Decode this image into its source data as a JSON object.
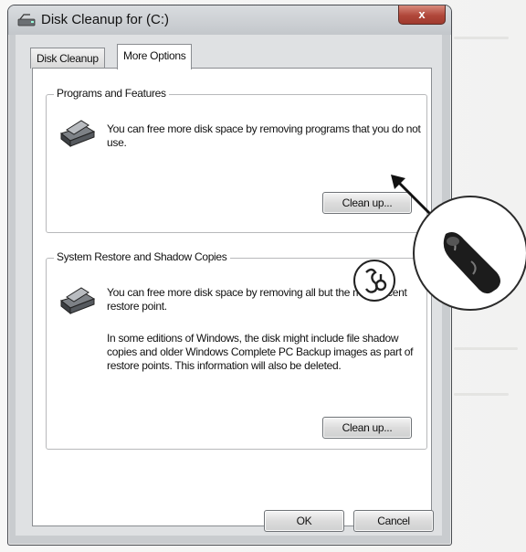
{
  "window": {
    "title": "Disk Cleanup for (C:)",
    "close_symbol": "x"
  },
  "tabs": [
    {
      "label": "Disk Cleanup",
      "active": false
    },
    {
      "label": "More Options",
      "active": true
    }
  ],
  "programs_group": {
    "legend": "Programs and Features",
    "text": "You can free more disk space by removing programs that you do not use.",
    "button_label": "Clean up..."
  },
  "restore_group": {
    "legend": "System Restore and Shadow Copies",
    "text1": "You can free more disk space by removing all but the most recent restore point.",
    "text2": "In some editions of Windows, the disk might include file shadow copies and older Windows Complete PC Backup images as part of restore points. This information will also be deleted.",
    "button_label": "Clean up..."
  },
  "footer": {
    "ok_label": "OK",
    "cancel_label": "Cancel"
  },
  "icons": [
    "disk-cleanup-title-icon",
    "programs-icon",
    "restore-icon",
    "close-icon",
    "hand-click-icon",
    "keyboard-shortcut-icon",
    "arrow-pointer"
  ]
}
